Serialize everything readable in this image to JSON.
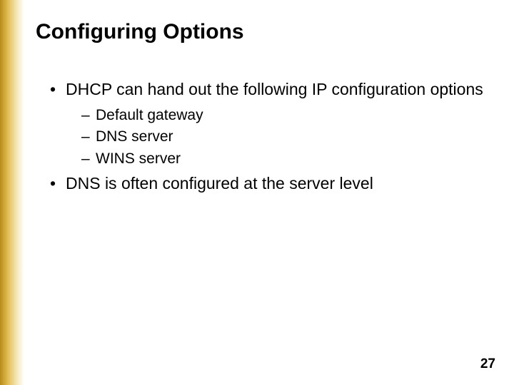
{
  "title": "Configuring Options",
  "bullets": {
    "b0": {
      "text": "DHCP can hand out the following IP configuration options",
      "sub": {
        "s0": "Default gateway",
        "s1": "DNS server",
        "s2": "WINS server"
      }
    },
    "b1": {
      "text": "DNS is often configured at the server level"
    }
  },
  "page_number": "27"
}
